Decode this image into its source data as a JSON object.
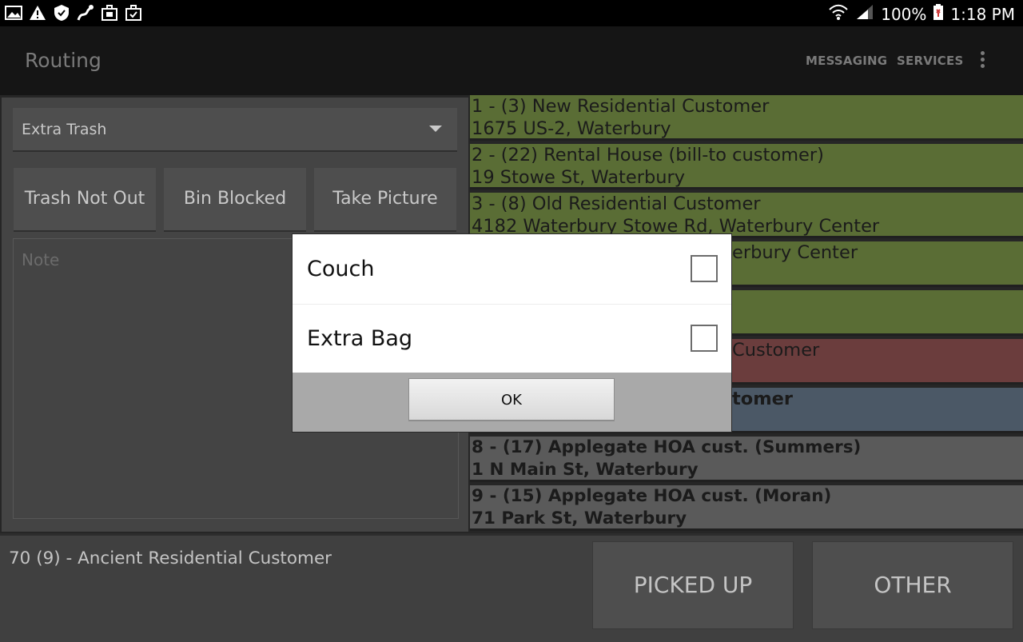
{
  "status_bar": {
    "notification_icons": [
      "image-icon",
      "warning-icon",
      "shield-icon",
      "route-icon",
      "briefcase-icon",
      "briefcase-check-icon"
    ],
    "battery_percent": "100%",
    "time": "1:18 PM"
  },
  "app_bar": {
    "title": "Routing",
    "messaging_label": "MESSAGING",
    "services_label": "SERVICES"
  },
  "left_panel": {
    "spinner_value": "Extra Trash",
    "buttons": [
      "Trash Not Out",
      "Bin Blocked",
      "Take Picture"
    ],
    "note_placeholder": "Note"
  },
  "stops": [
    {
      "line1": "1 - (3) New Residential Customer",
      "line2": "1675 US-2, Waterbury",
      "status": "green"
    },
    {
      "line1": "2 - (22) Rental House (bill-to customer)",
      "line2": "19 Stowe St, Waterbury",
      "status": "green"
    },
    {
      "line1": "3 - (8) Old Residential Customer",
      "line2": "4182 Waterbury Stowe Rd, Waterbury Center",
      "status": "green"
    },
    {
      "line1": "",
      "line2": "erbury Center",
      "status": "green"
    },
    {
      "line1": "",
      "line2": "",
      "status": "green"
    },
    {
      "line1": " Customer",
      "line2": "",
      "status": "red"
    },
    {
      "line1": "tomer",
      "line2": "",
      "status": "blue"
    },
    {
      "line1": "8 - (17) Applegate HOA cust. (Summers)",
      "line2": "1 N Main St, Waterbury",
      "status": "gray"
    },
    {
      "line1": "9 - (15) Applegate HOA cust. (Moran)",
      "line2": "71 Park St, Waterbury",
      "status": "gray"
    }
  ],
  "bottom_bar": {
    "current_customer": "70 (9) - Ancient Residential Customer",
    "picked_up_label": "PICKED UP",
    "other_label": "OTHER"
  },
  "dialog": {
    "options": [
      {
        "label": "Couch",
        "checked": false
      },
      {
        "label": "Extra Bag",
        "checked": false
      }
    ],
    "ok_label": "OK"
  }
}
